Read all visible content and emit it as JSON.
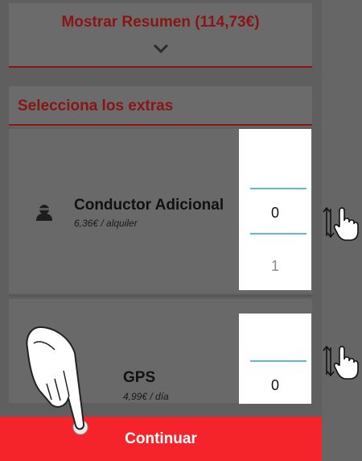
{
  "summary": {
    "label": "Mostrar Resumen (114,73€)",
    "expand_icon": "chevron-down-icon"
  },
  "extras": {
    "title": "Selecciona los extras",
    "items": [
      {
        "name": "Conductor Adicional",
        "price": "6,36€ / alquiler",
        "icon": "user-icon",
        "picker": {
          "selected": "0",
          "next": "1"
        }
      },
      {
        "name": "GPS",
        "price": "4,99€ / día",
        "icon": "",
        "picker": {
          "selected": "0"
        }
      }
    ]
  },
  "hints": {
    "scroll_icon": "swipe-up-down-hand-icon",
    "tap_icon": "tap-hand-icon"
  },
  "continue_button": {
    "label": "Continuar"
  },
  "colors": {
    "accent_red": "#8a1515",
    "button_red": "#f5232a",
    "picker_line": "#5fb8dd",
    "overlay_gray": "#6b6b6b"
  }
}
